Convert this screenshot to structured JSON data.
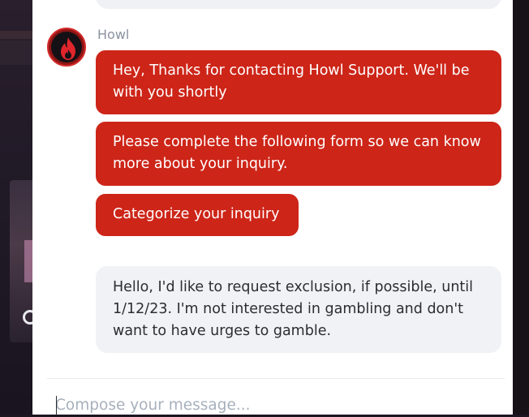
{
  "chat": {
    "sender_name": "Howl",
    "messages": [
      {
        "from": "bot",
        "text": "Hey, Thanks for contacting Howl Support. We'll be with you shortly"
      },
      {
        "from": "bot",
        "text": "Please complete the following form so we can know more about your inquiry."
      },
      {
        "from": "bot",
        "text": "Categorize your inquiry"
      },
      {
        "from": "user",
        "text": "Hello, I'd like to request exclusion, if possible, until 1/12/23. I'm not interested in gambling and don't want to have urges to gamble."
      }
    ]
  },
  "composer": {
    "placeholder": "Compose your message..."
  },
  "colors": {
    "bot_bubble": "#cd2518",
    "user_bubble": "#f1f2f5",
    "avatar_ring": "#d32a2a"
  },
  "icons": {
    "avatar": "flame-icon"
  }
}
